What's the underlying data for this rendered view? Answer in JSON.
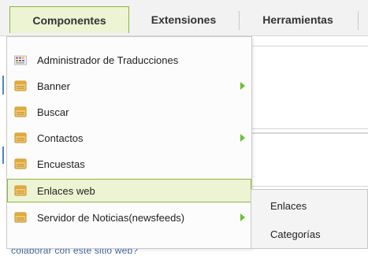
{
  "menubar": {
    "items": [
      {
        "label": "Componentes",
        "active": true
      },
      {
        "label": "Extensiones",
        "active": false
      },
      {
        "label": "Herramientas",
        "active": false
      }
    ]
  },
  "dropdown": {
    "items": [
      {
        "label": "Administrador de Traducciones",
        "icon": "translation-manager-icon",
        "has_submenu": false
      },
      {
        "label": "Banner",
        "icon": "component-box-icon",
        "has_submenu": true
      },
      {
        "label": "Buscar",
        "icon": "component-box-icon",
        "has_submenu": false
      },
      {
        "label": "Contactos",
        "icon": "component-box-icon",
        "has_submenu": true
      },
      {
        "label": "Encuestas",
        "icon": "component-box-icon",
        "has_submenu": false
      },
      {
        "label": "Enlaces web",
        "icon": "component-box-icon",
        "has_submenu": false,
        "highlighted": true
      },
      {
        "label": "Servidor de Noticias(newsfeeds)",
        "icon": "component-box-icon",
        "has_submenu": true
      }
    ]
  },
  "submenu": {
    "items": [
      {
        "label": "Enlaces"
      },
      {
        "label": "Categorías"
      }
    ]
  },
  "background": {
    "bottom_text": "colaborar con este sitio web?"
  },
  "colors": {
    "active_bg": "#ecf4d3",
    "active_border": "#8fb440",
    "submenu_arrow": "#6dbf2e",
    "link_blue": "#4468a5"
  }
}
